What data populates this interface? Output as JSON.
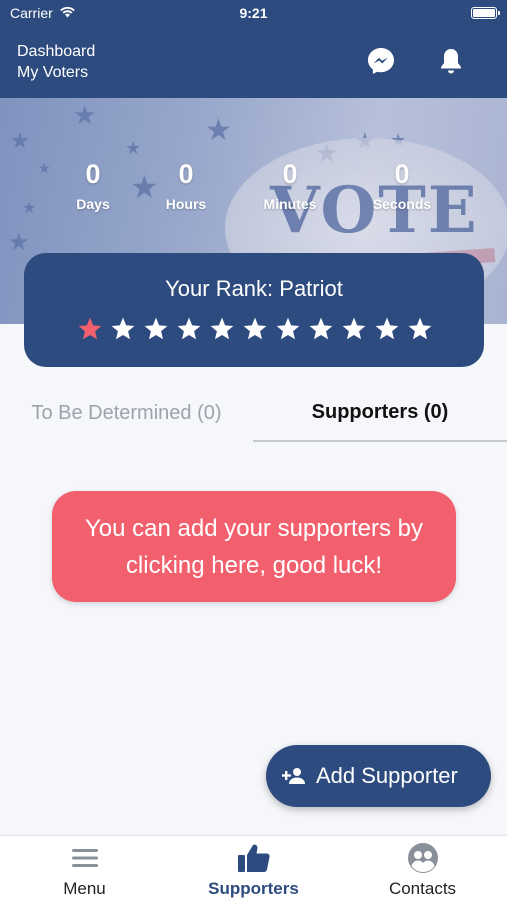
{
  "status_bar": {
    "carrier": "Carrier",
    "time": "9:21",
    "battery_level": 1.0
  },
  "header": {
    "title": "Dashboard",
    "subtitle": "My Voters",
    "icons": [
      "messenger-icon",
      "bell-icon"
    ]
  },
  "hero": {
    "background_badge_text": "VOTE",
    "countdown": [
      {
        "value": "0",
        "label": "Days"
      },
      {
        "value": "0",
        "label": "Hours"
      },
      {
        "value": "0",
        "label": "Minutes"
      },
      {
        "value": "0",
        "label": "Seconds"
      }
    ]
  },
  "rank": {
    "title": "Your Rank: Patriot",
    "stars_total": 11,
    "stars_filled": 1,
    "filled_color": "#f2606e",
    "empty_color": "#ffffff"
  },
  "tabs": [
    {
      "label": "To Be Determined (0)",
      "active": false
    },
    {
      "label": "Supporters (0)",
      "active": true
    }
  ],
  "hint": {
    "text": "You can add your supporters by clicking here, good luck!"
  },
  "fab": {
    "label": "Add Supporter",
    "icon": "add-person-icon"
  },
  "bottom_nav": [
    {
      "label": "Menu",
      "icon": "menu-icon",
      "active": false
    },
    {
      "label": "Supporters",
      "icon": "thumbs-up-icon",
      "active": true
    },
    {
      "label": "Contacts",
      "icon": "contacts-icon",
      "active": false
    }
  ],
  "colors": {
    "primary": "#2d4b7f",
    "accent": "#f2606e",
    "background": "#f5f7fa"
  }
}
